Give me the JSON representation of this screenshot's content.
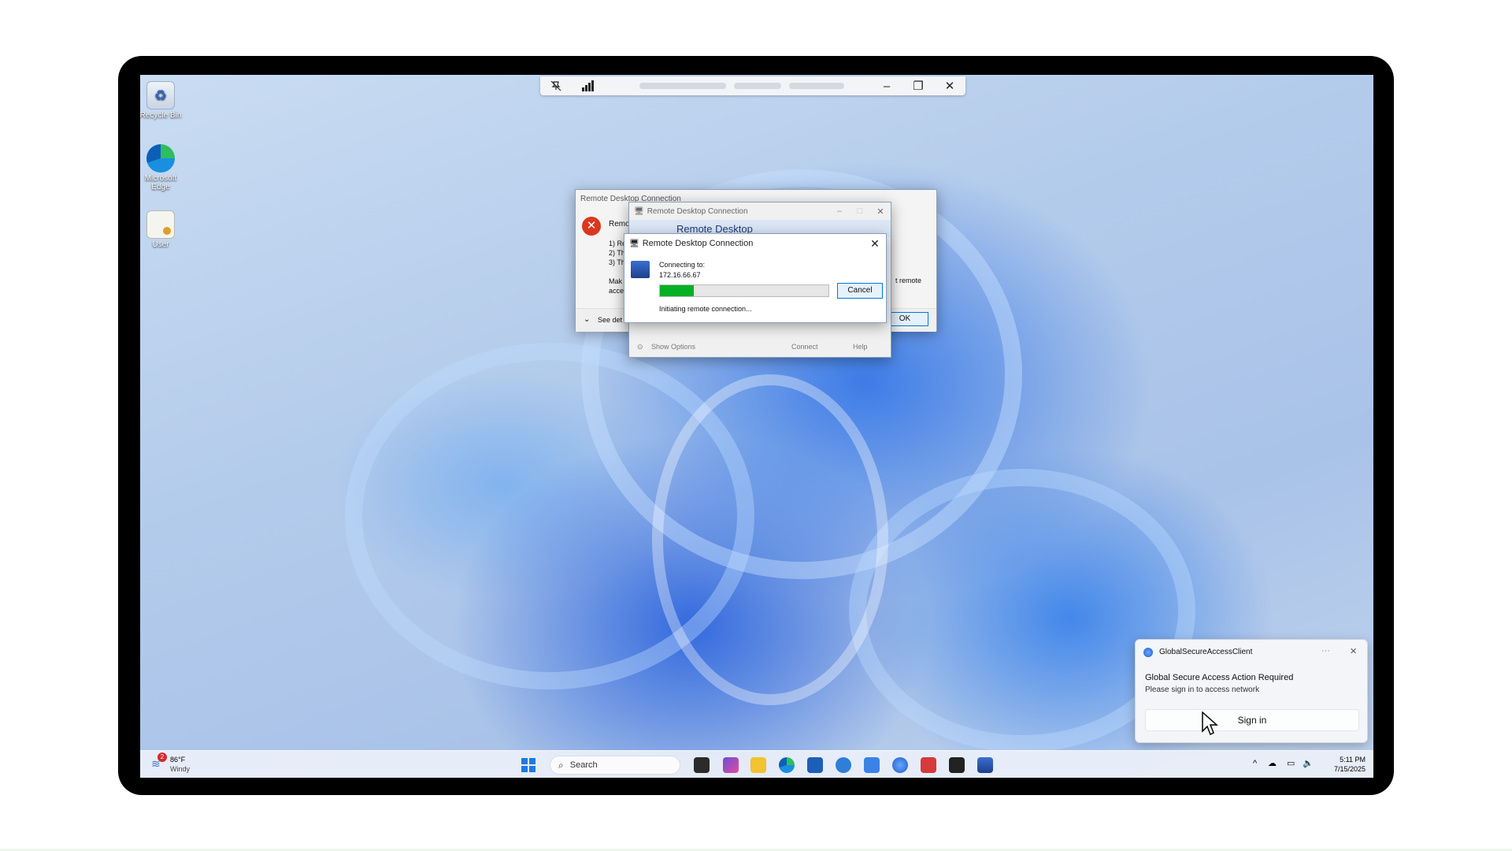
{
  "rdp_bar": {
    "pin_icon": "pin-off-icon",
    "signal_icon": "signal-bars-icon",
    "minimize": "–",
    "restore": "❐",
    "close": "✕"
  },
  "desktop_icons": [
    {
      "label": "Recycle Bin",
      "icon": "recycle-bin-icon"
    },
    {
      "label": "Microsoft Edge",
      "icon": "edge-icon"
    },
    {
      "label": "User",
      "icon": "certificate-icon"
    }
  ],
  "error_dialog": {
    "title": "Remote Desktop Connection",
    "heading_partial": "Remo",
    "lines": [
      "1) Re",
      "2) Th",
      "3) Th"
    ],
    "make_partial": "Mak",
    "acce_partial": "acce",
    "remote_partial": "t remote",
    "see_details": "See det",
    "ok": "OK",
    "icon": "error-icon"
  },
  "rdc_main": {
    "title": "Remote Desktop Connection",
    "banner": "Remote Desktop",
    "show_options": "Show Options",
    "connect": "Connect",
    "help": "Help"
  },
  "connecting": {
    "title": "Remote Desktop Connection",
    "connecting_to": "Connecting to:",
    "address": "172.16.66.67",
    "progress": 0.2,
    "cancel": "Cancel",
    "status": "Initiating remote connection..."
  },
  "toast": {
    "app": "GlobalSecureAccessClient",
    "more": "···",
    "close": "✕",
    "heading": "Global Secure Access Action Required",
    "body": "Please sign in to access network",
    "button": "Sign in"
  },
  "taskbar": {
    "weather_temp": "86°F",
    "weather_desc": "Windy",
    "weather_badge": "2",
    "search_placeholder": "Search",
    "time": "5:11 PM",
    "date": "7/15/2025",
    "tray_chevron": "^"
  }
}
